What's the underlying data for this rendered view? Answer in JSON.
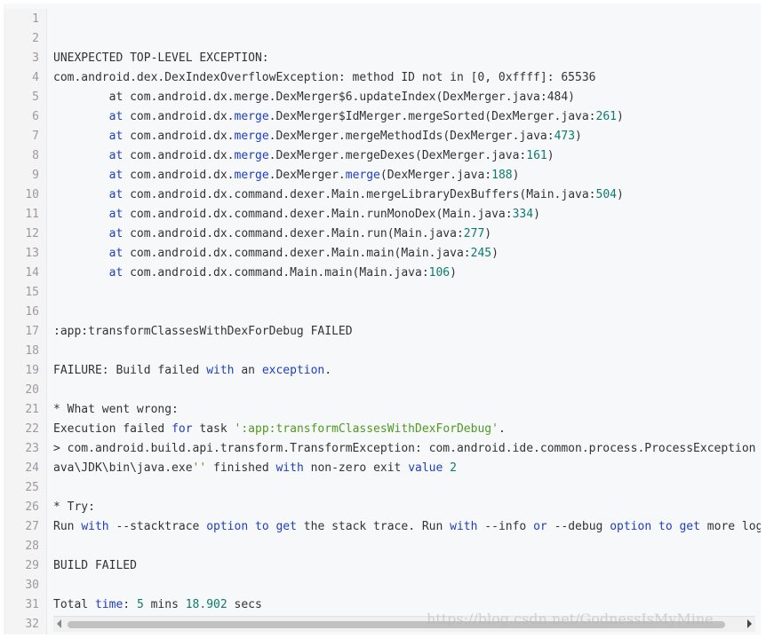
{
  "watermark": "https://blog.csdn.net/GodnessIsMyMine",
  "lines": [
    {
      "n": "1",
      "s": []
    },
    {
      "n": "2",
      "s": []
    },
    {
      "n": "3",
      "s": [
        {
          "t": "UNEXPECTED TOP-LEVEL EXCEPTION:"
        }
      ]
    },
    {
      "n": "4",
      "s": [
        {
          "t": "com.android.dex.DexIndexOverflowException: method ID not in [0, 0xffff]: 65536"
        }
      ]
    },
    {
      "n": "5",
      "s": [
        {
          "t": "        at com.android.dx.merge.DexMerger$6.updateIndex(DexMerger.java:484)"
        }
      ]
    },
    {
      "n": "6",
      "s": [
        {
          "t": "        "
        },
        {
          "t": "at",
          "c": "kw"
        },
        {
          "t": " com.android.dx."
        },
        {
          "t": "merge",
          "c": "kw"
        },
        {
          "t": ".DexMerger$IdMerger.mergeSorted(DexMerger.java:"
        },
        {
          "t": "261",
          "c": "num"
        },
        {
          "t": ")"
        }
      ]
    },
    {
      "n": "7",
      "s": [
        {
          "t": "        "
        },
        {
          "t": "at",
          "c": "kw"
        },
        {
          "t": " com.android.dx."
        },
        {
          "t": "merge",
          "c": "kw"
        },
        {
          "t": ".DexMerger.mergeMethodIds(DexMerger.java:"
        },
        {
          "t": "473",
          "c": "num"
        },
        {
          "t": ")"
        }
      ]
    },
    {
      "n": "8",
      "s": [
        {
          "t": "        "
        },
        {
          "t": "at",
          "c": "kw"
        },
        {
          "t": " com.android.dx."
        },
        {
          "t": "merge",
          "c": "kw"
        },
        {
          "t": ".DexMerger.mergeDexes(DexMerger.java:"
        },
        {
          "t": "161",
          "c": "num"
        },
        {
          "t": ")"
        }
      ]
    },
    {
      "n": "9",
      "s": [
        {
          "t": "        "
        },
        {
          "t": "at",
          "c": "kw"
        },
        {
          "t": " com.android.dx."
        },
        {
          "t": "merge",
          "c": "kw"
        },
        {
          "t": ".DexMerger."
        },
        {
          "t": "merge",
          "c": "kw"
        },
        {
          "t": "(DexMerger.java:"
        },
        {
          "t": "188",
          "c": "num"
        },
        {
          "t": ")"
        }
      ]
    },
    {
      "n": "10",
      "s": [
        {
          "t": "        "
        },
        {
          "t": "at",
          "c": "kw"
        },
        {
          "t": " com.android.dx.command.dexer.Main.mergeLibraryDexBuffers(Main.java:"
        },
        {
          "t": "504",
          "c": "num"
        },
        {
          "t": ")"
        }
      ]
    },
    {
      "n": "11",
      "s": [
        {
          "t": "        "
        },
        {
          "t": "at",
          "c": "kw"
        },
        {
          "t": " com.android.dx.command.dexer.Main.runMonoDex(Main.java:"
        },
        {
          "t": "334",
          "c": "num"
        },
        {
          "t": ")"
        }
      ]
    },
    {
      "n": "12",
      "s": [
        {
          "t": "        "
        },
        {
          "t": "at",
          "c": "kw"
        },
        {
          "t": " com.android.dx.command.dexer.Main.run(Main.java:"
        },
        {
          "t": "277",
          "c": "num"
        },
        {
          "t": ")"
        }
      ]
    },
    {
      "n": "13",
      "s": [
        {
          "t": "        "
        },
        {
          "t": "at",
          "c": "kw"
        },
        {
          "t": " com.android.dx.command.dexer.Main.main(Main.java:"
        },
        {
          "t": "245",
          "c": "num"
        },
        {
          "t": ")"
        }
      ]
    },
    {
      "n": "14",
      "s": [
        {
          "t": "        "
        },
        {
          "t": "at",
          "c": "kw"
        },
        {
          "t": " com.android.dx.command.Main.main(Main.java:"
        },
        {
          "t": "106",
          "c": "num"
        },
        {
          "t": ")"
        }
      ]
    },
    {
      "n": "15",
      "s": []
    },
    {
      "n": "16",
      "s": []
    },
    {
      "n": "17",
      "s": [
        {
          "t": ":app:transformClassesWithDexForDebug FAILED"
        }
      ]
    },
    {
      "n": "18",
      "s": []
    },
    {
      "n": "19",
      "s": [
        {
          "t": "FAILURE: Build failed "
        },
        {
          "t": "with",
          "c": "kw"
        },
        {
          "t": " an "
        },
        {
          "t": "exception",
          "c": "kw"
        },
        {
          "t": "."
        }
      ]
    },
    {
      "n": "20",
      "s": []
    },
    {
      "n": "21",
      "s": [
        {
          "t": "* What went wrong:"
        }
      ]
    },
    {
      "n": "22",
      "s": [
        {
          "t": "Execution failed "
        },
        {
          "t": "for",
          "c": "kw"
        },
        {
          "t": " task "
        },
        {
          "t": "':app:transformClassesWithDexForDebug'",
          "c": "str"
        },
        {
          "t": "."
        }
      ]
    },
    {
      "n": "23",
      "s": [
        {
          "t": "> com.android.build.api.transform.TransformException: com.android.ide.common.process.ProcessException"
        }
      ]
    },
    {
      "n": "24",
      "s": [
        {
          "t": "ava\\JDK\\bin\\java.exe"
        },
        {
          "t": "''",
          "c": "str"
        },
        {
          "t": " finished "
        },
        {
          "t": "with",
          "c": "kw"
        },
        {
          "t": " non-zero exit "
        },
        {
          "t": "value",
          "c": "kw"
        },
        {
          "t": " "
        },
        {
          "t": "2",
          "c": "num"
        }
      ]
    },
    {
      "n": "25",
      "s": []
    },
    {
      "n": "26",
      "s": [
        {
          "t": "* Try:"
        }
      ]
    },
    {
      "n": "27",
      "s": [
        {
          "t": "Run "
        },
        {
          "t": "with",
          "c": "kw"
        },
        {
          "t": " --stacktrace "
        },
        {
          "t": "option",
          "c": "kw"
        },
        {
          "t": " "
        },
        {
          "t": "to",
          "c": "kw"
        },
        {
          "t": " "
        },
        {
          "t": "get",
          "c": "kw"
        },
        {
          "t": " the stack trace. Run "
        },
        {
          "t": "with",
          "c": "kw"
        },
        {
          "t": " --info "
        },
        {
          "t": "or",
          "c": "kw"
        },
        {
          "t": " --debug "
        },
        {
          "t": "option",
          "c": "kw"
        },
        {
          "t": " "
        },
        {
          "t": "to",
          "c": "kw"
        },
        {
          "t": " "
        },
        {
          "t": "get",
          "c": "kw"
        },
        {
          "t": " more log"
        }
      ]
    },
    {
      "n": "28",
      "s": []
    },
    {
      "n": "29",
      "s": [
        {
          "t": "BUILD FAILED"
        }
      ]
    },
    {
      "n": "30",
      "s": []
    },
    {
      "n": "31",
      "s": [
        {
          "t": "Total "
        },
        {
          "t": "time",
          "c": "kw"
        },
        {
          "t": ": "
        },
        {
          "t": "5",
          "c": "num"
        },
        {
          "t": " mins "
        },
        {
          "t": "18.902",
          "c": "num"
        },
        {
          "t": " secs"
        }
      ]
    },
    {
      "n": "32",
      "s": []
    }
  ]
}
